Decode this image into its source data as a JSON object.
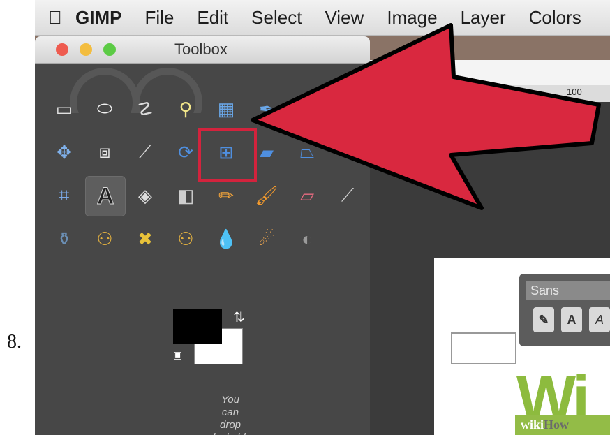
{
  "step_number": "8.",
  "menubar": {
    "apple_icon": "apple-icon",
    "items": [
      "GIMP",
      "File",
      "Edit",
      "Select",
      "View",
      "Image",
      "Layer",
      "Colors"
    ]
  },
  "toolbox": {
    "title": "Toolbox",
    "tools": [
      {
        "name": "rect-select-tool",
        "glyph": "▭"
      },
      {
        "name": "ellipse-select-tool",
        "glyph": "⬭"
      },
      {
        "name": "free-select-tool",
        "glyph": "☡"
      },
      {
        "name": "fuzzy-select-tool",
        "glyph": "⚲"
      },
      {
        "name": "select-by-color-tool",
        "glyph": "▦"
      },
      {
        "name": "paths-tool",
        "glyph": "✒"
      },
      {
        "name": "zoom-tool",
        "glyph": "🔍"
      },
      {
        "name": "measure-tool",
        "glyph": "⩘"
      },
      {
        "name": "move-tool",
        "glyph": "✥"
      },
      {
        "name": "align-tool",
        "glyph": "⧈"
      },
      {
        "name": "crop-tool",
        "glyph": "⟋"
      },
      {
        "name": "rotate-tool",
        "glyph": "⟳"
      },
      {
        "name": "scale-tool",
        "glyph": "⊞"
      },
      {
        "name": "shear-tool",
        "glyph": "▰"
      },
      {
        "name": "perspective-tool",
        "glyph": "⏢"
      },
      {
        "name": "flip-tool",
        "glyph": "⇔"
      },
      {
        "name": "cage-tool",
        "glyph": "⌗"
      },
      {
        "name": "text-tool",
        "glyph": "A"
      },
      {
        "name": "bucket-fill-tool",
        "glyph": "◈"
      },
      {
        "name": "blend-tool",
        "glyph": "◧"
      },
      {
        "name": "pencil-tool",
        "glyph": "✏"
      },
      {
        "name": "paintbrush-tool",
        "glyph": "🖌"
      },
      {
        "name": "eraser-tool",
        "glyph": "▱"
      },
      {
        "name": "airbrush-tool",
        "glyph": "⟋"
      },
      {
        "name": "ink-tool",
        "glyph": "⚱"
      },
      {
        "name": "clone-tool",
        "glyph": "⚇"
      },
      {
        "name": "heal-tool",
        "glyph": "✖"
      },
      {
        "name": "perspective-clone-tool",
        "glyph": "⚇"
      },
      {
        "name": "blur-tool",
        "glyph": "💧"
      },
      {
        "name": "smudge-tool",
        "glyph": "☄"
      },
      {
        "name": "dodge-burn-tool",
        "glyph": "◐"
      }
    ],
    "colors": {
      "foreground": "#000000",
      "background": "#ffffff"
    },
    "drop_hint": [
      "You",
      "can",
      "drop",
      "dockable"
    ]
  },
  "image_window": {
    "ruler_label": "100",
    "font_panel": {
      "font": "Sans",
      "buttons": [
        "A",
        "A"
      ]
    },
    "watermark": {
      "letters": "Wi",
      "brand_main": "wiki",
      "brand_accent": "How"
    }
  },
  "accent_colors": {
    "highlight": "#d3233d",
    "arrow": "#d9283f"
  }
}
